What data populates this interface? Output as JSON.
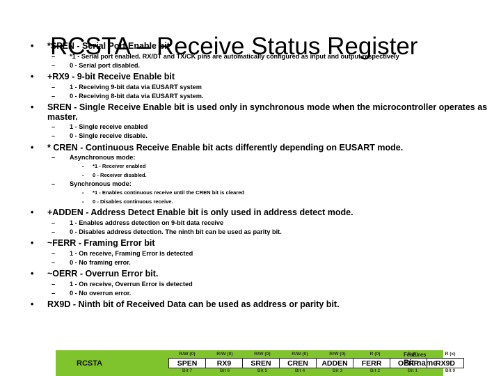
{
  "slide": {
    "title": "RCSTA – Receive Status Register",
    "bullet_glyph": "•",
    "dash_glyph": "–",
    "square_glyph": "▪",
    "accent_green": "#7FC42D",
    "background": "#FFFFFF",
    "content": [
      {
        "level": 1,
        "text": "*SPEN - Serial Port Enable bit"
      },
      {
        "level": 2,
        "text": "*1 - Serial port enabled. RX/DT and TX/CK pins are automatically configured as input and output  respectively"
      },
      {
        "level": 2,
        "text": "0 - Serial port disabled."
      },
      {
        "level": 1,
        "text": "+RX9 - 9-bit Receive Enable bit"
      },
      {
        "level": 2,
        "text": "1 - Receiving 9-bit data via EUSART system"
      },
      {
        "level": 2,
        "text": "0 - Receiving 8-bit data via EUSART system."
      },
      {
        "level": 1,
        "text": "SREN - Single Receive Enable bit is used only in synchronous mode when the microcontroller operates as master."
      },
      {
        "level": 2,
        "text": "1 - Single receive enabled"
      },
      {
        "level": 2,
        "text": "0 - Single receive disable."
      },
      {
        "level": 1,
        "text": "* CREN - Continuous Receive Enable bit acts differently depending on EUSART mode."
      },
      {
        "level": 2,
        "text": "Asynchronous mode:"
      },
      {
        "level": 3,
        "text": "*1 - Receiver enabled"
      },
      {
        "level": 3,
        "text": "0 - Receiver disabled."
      },
      {
        "level": 2,
        "text": "Synchronous mode:"
      },
      {
        "level": 3,
        "text": "*1 - Enables continuous receive until the CREN bit is cleared"
      },
      {
        "level": 3,
        "text": "0 - Disables continuous receive."
      },
      {
        "level": 1,
        "text": "+ADDEN - Address Detect Enable bit is only used in address detect mode."
      },
      {
        "level": 2,
        "text": "1 - Enables address detection on 9-bit data receive"
      },
      {
        "level": 2,
        "text": "0 - Disables address detection. The ninth bit can be used as parity bit."
      },
      {
        "level": 1,
        "text": "~FERR - Framing Error bit"
      },
      {
        "level": 2,
        "text": "1 - On receive, Framing Error is detected"
      },
      {
        "level": 2,
        "text": "0 - No framing error."
      },
      {
        "level": 1,
        "text": "~OERR - Overrun Error bit."
      },
      {
        "level": 2,
        "text": "1 - On receive, Overrun Error is detected"
      },
      {
        "level": 2,
        "text": "0 - No overrun error."
      },
      {
        "level": 1,
        "text": "RX9D - Ninth bit of Received Data can be used as address or parity bit."
      }
    ]
  },
  "register_figure": {
    "register_name": "RCSTA",
    "features_label": "Features",
    "bit_name_label": "Bit name",
    "bits": [
      {
        "name": "SPEN",
        "access": "R/W (0)",
        "bit": "Bit 7"
      },
      {
        "name": "RX9",
        "access": "R/W (0)",
        "bit": "Bit 6"
      },
      {
        "name": "SREN",
        "access": "R/W (0)",
        "bit": "Bit 5"
      },
      {
        "name": "CREN",
        "access": "R/W (0)",
        "bit": "Bit 4"
      },
      {
        "name": "ADDEN",
        "access": "R/W (0)",
        "bit": "Bit 3"
      },
      {
        "name": "FERR",
        "access": "R (0)",
        "bit": "Bit 2"
      },
      {
        "name": "OERR",
        "access": "R (0)",
        "bit": "Bit 1"
      },
      {
        "name": "RX9D",
        "access": "R (x)",
        "bit": "Bit 0"
      }
    ]
  }
}
